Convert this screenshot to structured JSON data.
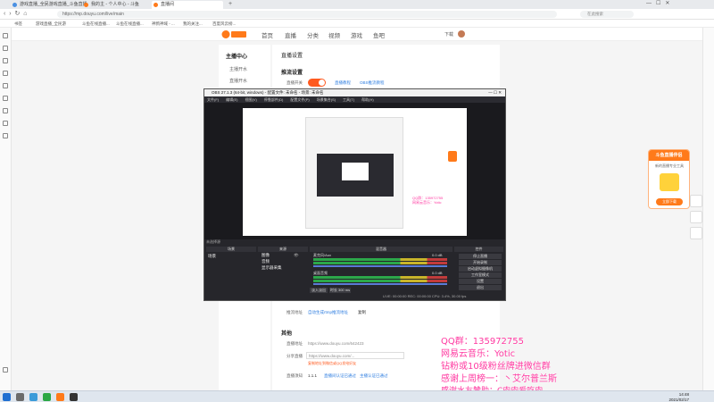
{
  "browser": {
    "tabs": [
      {
        "label": "游戏直播_全民游戏直播_斗鱼直播",
        "active": false
      },
      {
        "label": "我的主 - 个人中心 - 斗鱼",
        "active": false
      },
      {
        "label": "直播间",
        "active": true
      }
    ],
    "url": "https://mp.douyu.com/live/main",
    "search_placeholder": "在此搜索",
    "bookmarks": [
      "书签",
      "游戏直播_全民游",
      "斗鱼在线直播...",
      "斗鱼在线直播...",
      "神鸦神域 - ...",
      "我的关注...",
      "百度风云榜..."
    ]
  },
  "douyu": {
    "nav": [
      "首页",
      "直播",
      "分类",
      "视频",
      "游戏",
      "鱼吧"
    ],
    "header_right": "下载",
    "side_title": "主播中心",
    "side_items": [
      "主播开水",
      "直播开水"
    ],
    "section_title": "直播设置",
    "sub_title": "推流设置",
    "toggle_label": "直播开关",
    "toggle_links": [
      "直播教程",
      "OBS推流教程"
    ],
    "bottom_label": "推流地址",
    "bottom_link": "自动生成rtmp推流地址",
    "bottom_copy": "复制",
    "other_title": "其他",
    "live_url_label": "直播地址",
    "live_url_value": "https://www.douyu.com/642423",
    "share_label": "分享直播",
    "share_value": "https://www.douyu.com/...",
    "share_note": "复制地址到微信或QQ发给好友",
    "notice_label": "直播须知",
    "notice_value": "1.1.1",
    "notice_link": "直播间认证已通过",
    "notice_link2": "主播认证已通过"
  },
  "obs": {
    "title": "OBS 27.1.3 (64-bit, windows) - 配置文件: 未命名 - 场景: 未命名",
    "menu": [
      "文件(F)",
      "编辑(E)",
      "视图(V)",
      "停靠部件(D)",
      "配置文件(P)",
      "场景集合(S)",
      "工具(T)",
      "帮助(H)"
    ],
    "status_left": "未选择源",
    "status_right": "LIVE: 00:00:00  REC: 00:00:00  CPU: 3.4%, 30.00 fps",
    "panels": [
      "场景",
      "来源",
      "混音器",
      "转场动画",
      "控件"
    ],
    "scene_name": "场景",
    "sources": [
      "图像",
      "音频",
      "显示器采集"
    ],
    "mixer_tracks": [
      "麦克风/Aux",
      "桌面音频"
    ],
    "mixer_db": [
      "0.0 dB",
      "0.0 dB"
    ],
    "transitions": [
      "淡入淡出",
      "时长 300 ms"
    ],
    "controls": [
      "停止直播",
      "开始录制",
      "启动虚拟摄像机",
      "工作室模式",
      "设置",
      "退出"
    ]
  },
  "overlay": {
    "lines": [
      "QQ群：135972755",
      "网易云音乐：Yotic",
      "钻粉或10级粉丝牌进微信群",
      "感谢上周榜一：丶艾尔普兰斯",
      "感谢水友赞助：C肉肉爱吃肉"
    ],
    "color": "#ff3aa1"
  },
  "promo": {
    "title": "斗鱼直播伴侣",
    "subtitle": "新的直播专业工具",
    "button": "立即下载"
  },
  "taskbar": {
    "time": "14:48",
    "date": "2021/02/17"
  },
  "colors": {
    "douyu_orange": "#ff5a1f",
    "obs_bg": "#1f1f24"
  }
}
